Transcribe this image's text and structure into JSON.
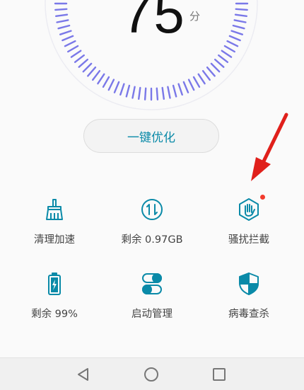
{
  "score": {
    "value": "75",
    "unit": "分"
  },
  "optimize_button": {
    "label": "一键优化"
  },
  "tiles": [
    {
      "label": "清理加速",
      "icon": "broom-icon"
    },
    {
      "label": "剩余 0.97GB",
      "icon": "data-transfer-icon"
    },
    {
      "label": "骚扰拦截",
      "icon": "hand-block-icon",
      "badge": "red-dot"
    },
    {
      "label": "剩余 99%",
      "icon": "battery-icon"
    },
    {
      "label": "启动管理",
      "icon": "toggle-icon"
    },
    {
      "label": "病毒查杀",
      "icon": "shield-icon"
    }
  ],
  "colors": {
    "accent": "#0a8aa8",
    "gauge": "#7a78e8",
    "badge": "#f23b2c",
    "annotation_arrow": "#e0201b"
  },
  "navbar": {
    "back": "back-triangle-icon",
    "home": "home-circle-icon",
    "recents": "recents-square-icon"
  }
}
